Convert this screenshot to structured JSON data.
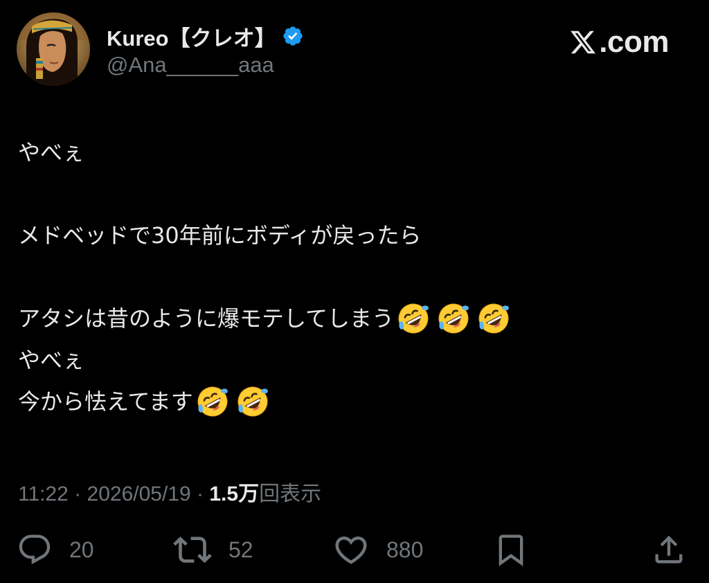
{
  "author": {
    "display_name": "Kureo【クレオ】",
    "handle": "@Ana______aaa",
    "verified": true
  },
  "brand": {
    "logo_text": ".com",
    "logo_icon": "x-logo-icon"
  },
  "tweet": {
    "lines": [
      "やべぇ",
      "",
      "メドベッドで30年前にボディが戻ったら",
      "",
      "アタシは昔のように爆モテしてしまう",
      "やべぇ",
      "今から怯えてます"
    ],
    "emoji": {
      "line4": [
        "rolling-on-floor-laughing",
        "rolling-on-floor-laughing",
        "rolling-on-floor-laughing"
      ],
      "line6": [
        "rolling-on-floor-laughing",
        "rolling-on-floor-laughing"
      ]
    }
  },
  "meta": {
    "time": "11:22",
    "separator": " · ",
    "date": "2026/05/19",
    "views_count": "1.5万",
    "views_label": "回表示"
  },
  "actions": {
    "reply_count": "20",
    "retweet_count": "52",
    "like_count": "880"
  },
  "colors": {
    "background": "#000000",
    "primary_text": "#e7e9ea",
    "secondary_text": "#71767b",
    "verified_blue": "#1d9bf0"
  }
}
